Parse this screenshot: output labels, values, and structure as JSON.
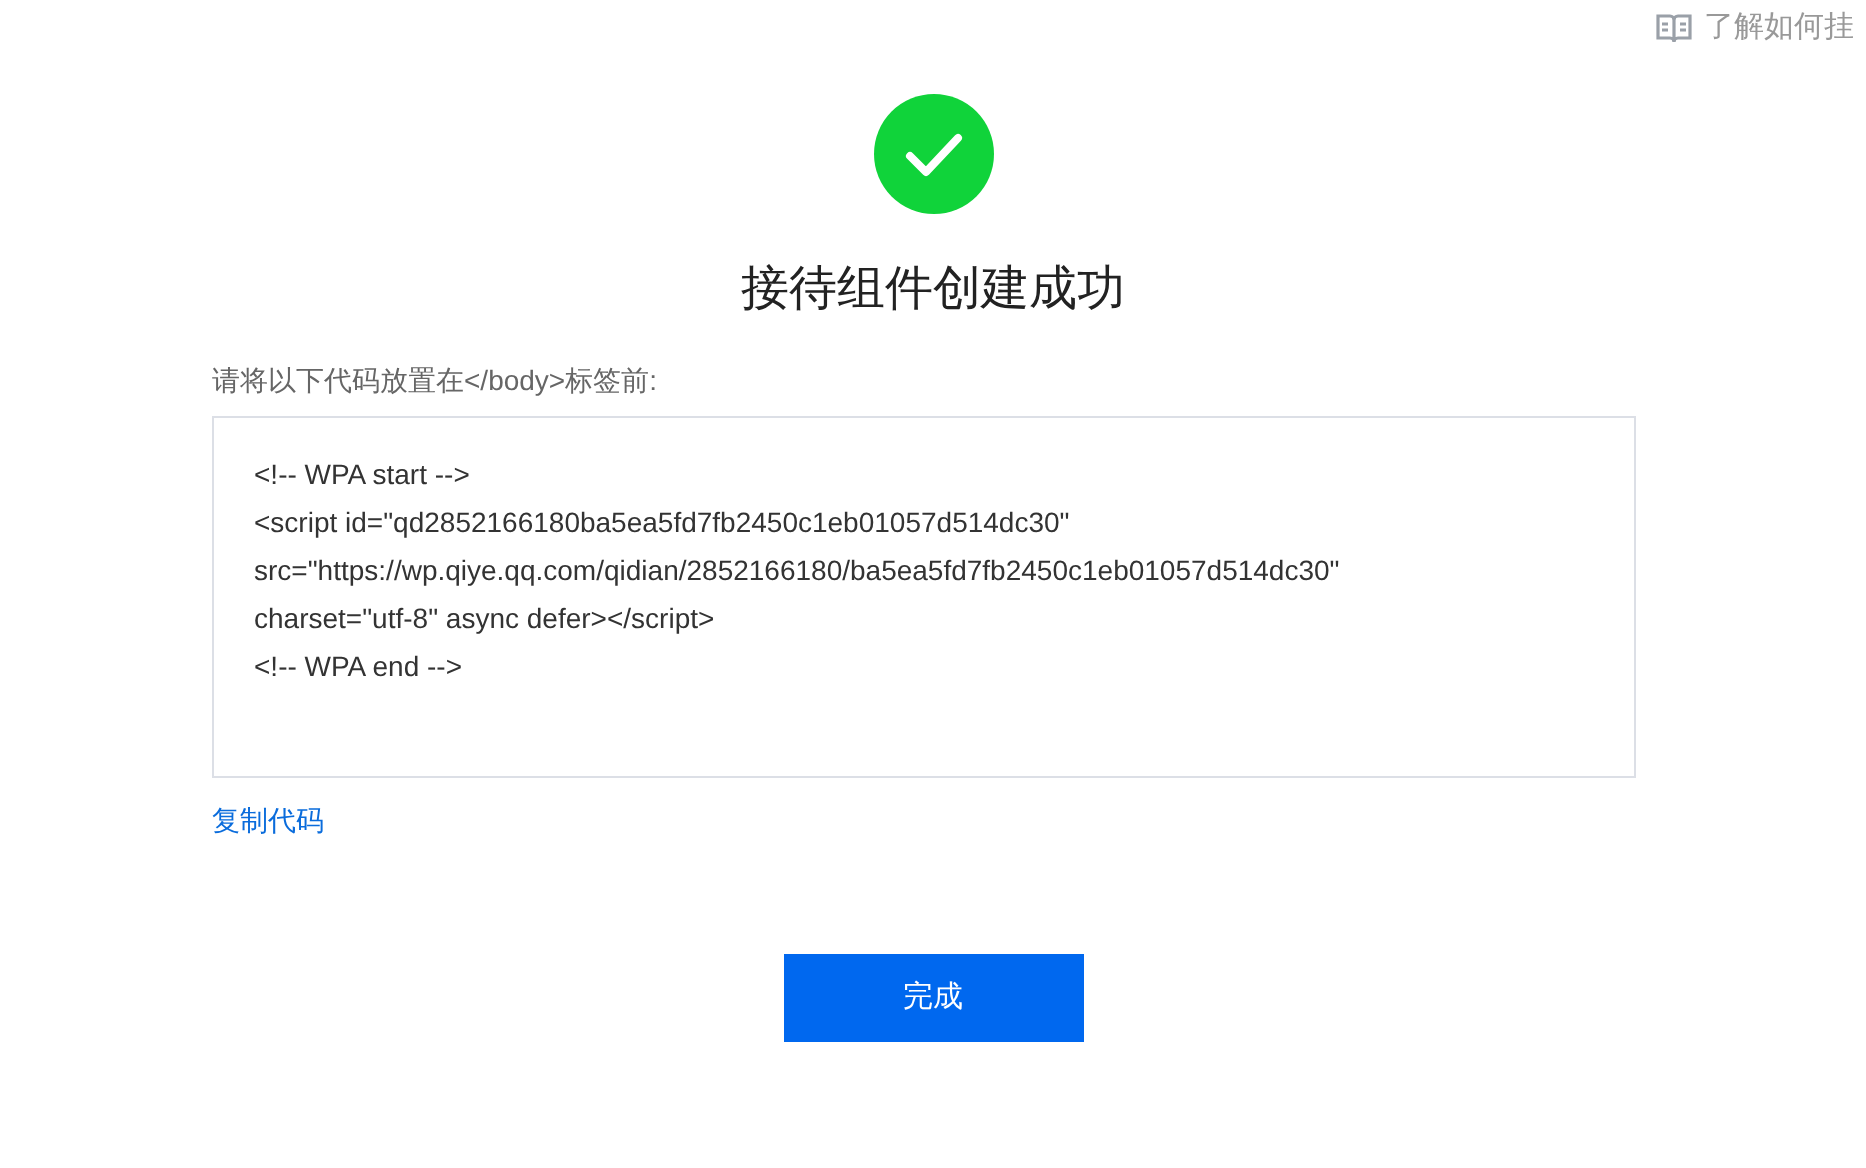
{
  "help_link": "了解如何挂",
  "title": "接待组件创建成功",
  "instruction": "请将以下代码放置在</body>标签前:",
  "code_lines": [
    "<!-- WPA start -->",
    "<script id=\"qd2852166180ba5ea5fd7fb2450c1eb01057d514dc30\"",
    "src=\"https://wp.qiye.qq.com/qidian/2852166180/ba5ea5fd7fb2450c1eb01057d514dc30\"",
    "charset=\"utf-8\" async defer></script>",
    "<!-- WPA end -->"
  ],
  "copy_link": "复制代码",
  "done_button": "完成"
}
